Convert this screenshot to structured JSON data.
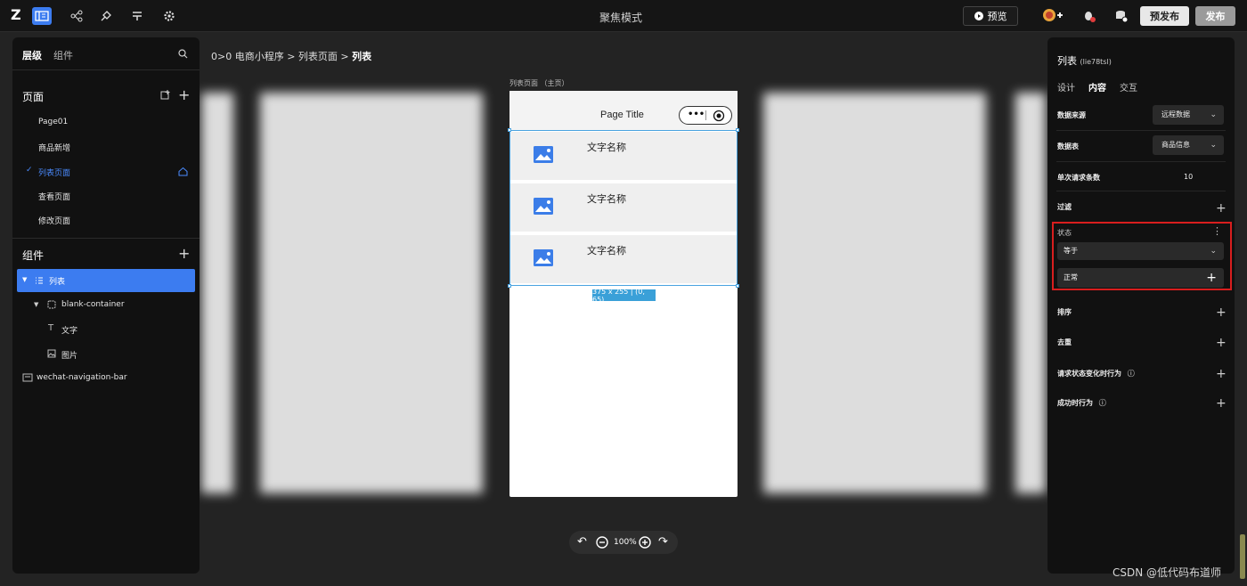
{
  "topbar": {
    "logo": "Z",
    "title": "聚焦模式",
    "preview_label": "预览",
    "prepublish_label": "预发布",
    "publish_label": "发布"
  },
  "left_panel": {
    "tabs": [
      "层级",
      "组件"
    ],
    "pages_title": "页面",
    "pages": [
      "Page01",
      "商品新增",
      "列表页面",
      "查看页面",
      "修改页面"
    ],
    "components_title": "组件",
    "tree": {
      "list": "列表",
      "container": "blank-container",
      "text": "文字",
      "image": "图片",
      "navbar": "wechat-navigation-bar"
    }
  },
  "breadcrumb": {
    "prefix": "0>0",
    "path": "电商小程序 > 列表页面 > ",
    "current": "列表"
  },
  "canvas": {
    "phone_label": "列表页面 （主页）",
    "page_title": "Page Title",
    "items": [
      "文字名称",
      "文字名称",
      "文字名称"
    ],
    "dimension_tag": "375 x 255 | (0, 65)",
    "zoom": "100%"
  },
  "right_panel": {
    "title": "列表",
    "title_id": "(lie78tsl)",
    "tabs": [
      "设计",
      "内容",
      "交互"
    ],
    "data_source_label": "数据来源",
    "data_source_value": "远程数据",
    "data_table_label": "数据表",
    "data_table_value": "商品信息",
    "page_size_label": "单次请求条数",
    "page_size_value": "10",
    "filter_label": "过滤",
    "filter_field": "状态",
    "filter_operator": "等于",
    "filter_value": "正常",
    "sort_label": "排序",
    "dedupe_label": "去重",
    "on_status_change_label": "请求状态变化时行为",
    "on_success_label": "成功时行为"
  },
  "watermark": "CSDN @低代码布道师",
  "colors": {
    "accent": "#3c7cf0",
    "highlight_border": "#d81e1e",
    "selection": "#4aa3e0"
  }
}
